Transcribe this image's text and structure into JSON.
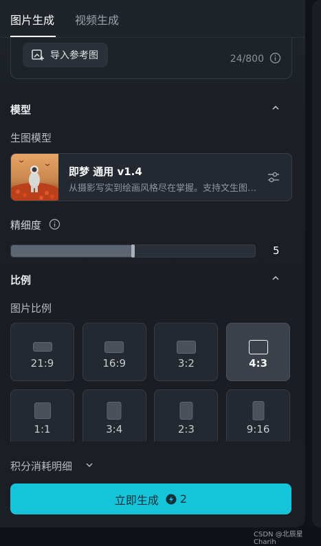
{
  "tabs": [
    {
      "label": "图片生成",
      "active": true
    },
    {
      "label": "视频生成",
      "active": false
    }
  ],
  "prompt": {
    "ref_button_label": "导入参考图",
    "counter": "24/800",
    "ref_icon": "image-import-icon",
    "info_icon": "info-icon"
  },
  "model_section": {
    "title": "模型",
    "sub_label": "生图模型",
    "model": {
      "name": "即梦 通用 v1.4",
      "description": "从摄影写实到绘画风格尽在掌握。支持文生图和图生图"
    }
  },
  "detail": {
    "label": "精细度",
    "value": "5",
    "fraction": 0.5
  },
  "ratio_section": {
    "title": "比例",
    "sub_label": "图片比例",
    "options": [
      {
        "label": "21:9",
        "selected": false
      },
      {
        "label": "16:9",
        "selected": false
      },
      {
        "label": "3:2",
        "selected": false
      },
      {
        "label": "4:3",
        "selected": true
      },
      {
        "label": "1:1",
        "selected": false
      },
      {
        "label": "3:4",
        "selected": false
      },
      {
        "label": "2:3",
        "selected": false
      },
      {
        "label": "9:16",
        "selected": false
      }
    ]
  },
  "footer": {
    "points_detail_label": "积分消耗明细",
    "generate_label": "立即生成",
    "cost": "2"
  },
  "watermark": "CSDN @北辰星Charih",
  "colors": {
    "accent": "#16c4da",
    "panel_bg": "#1b1f25"
  }
}
